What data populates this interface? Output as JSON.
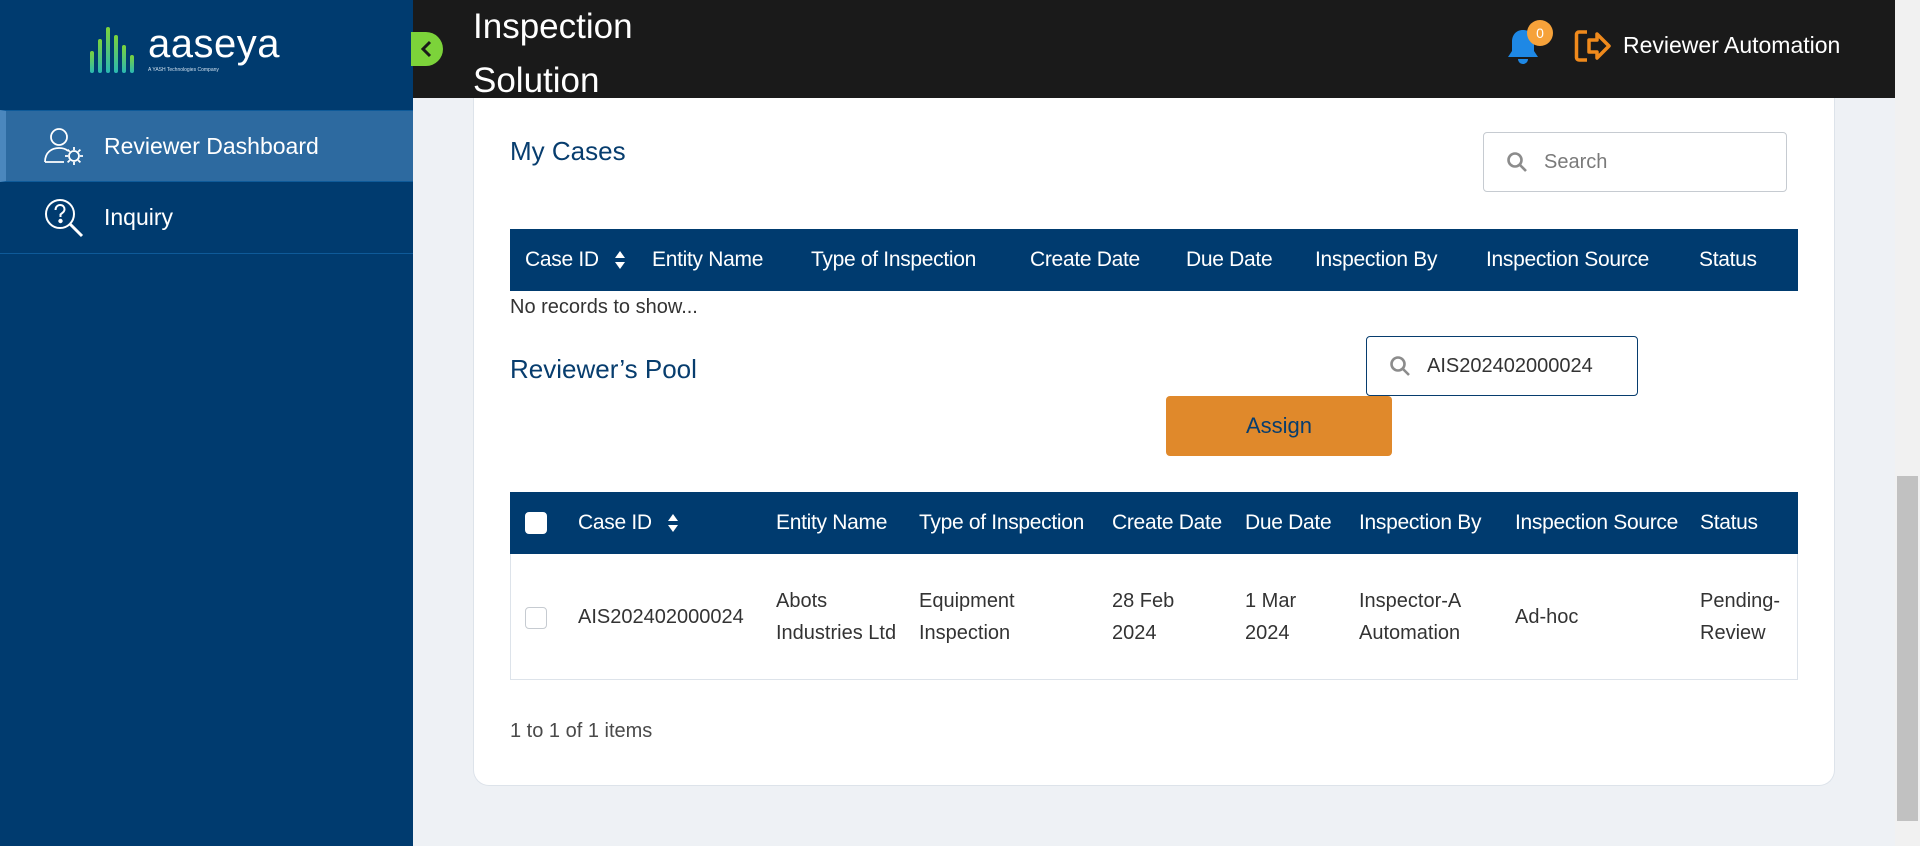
{
  "sidebar": {
    "logo_text": "aaseya",
    "logo_sub": "A YASH Technologies Company",
    "items": [
      {
        "label": "Reviewer Dashboard",
        "icon": "user-gear-icon",
        "active": true
      },
      {
        "label": "Inquiry",
        "icon": "question-search-icon",
        "active": false
      }
    ]
  },
  "header": {
    "title": "Inspection Solution",
    "notification_count": "0",
    "user_name": "Reviewer Automation"
  },
  "my_cases": {
    "title": "My Cases",
    "search_placeholder": "Search",
    "columns": [
      "Case ID",
      "Entity Name",
      "Type of Inspection",
      "Create Date",
      "Due Date",
      "Inspection By",
      "Inspection Source",
      "Status"
    ],
    "empty_text": "No records to show..."
  },
  "reviewers_pool": {
    "title": "Reviewer’s Pool",
    "search_value": "AIS202402000024",
    "assign_label": "Assign",
    "columns": [
      "Case ID",
      "Entity Name",
      "Type of Inspection",
      "Create Date",
      "Due Date",
      "Inspection By",
      "Inspection Source",
      "Status"
    ],
    "rows": [
      {
        "case_id": "AIS202402000024",
        "entity_name": "Abots Industries Ltd",
        "type": "Equipment Inspection",
        "create_date": "28 Feb 2024",
        "due_date": "1 Mar 2024",
        "inspection_by": "Inspector-A Automation",
        "source": "Ad-hoc",
        "status": "Pending-Review"
      }
    ],
    "pager_text": "1 to 1 of 1 items"
  },
  "colors": {
    "navy": "#003b6f",
    "accent_green": "#7cd33a",
    "assign_orange": "#e0892b",
    "bell_blue": "#1e88e5",
    "logout_orange": "#f08a1c"
  }
}
